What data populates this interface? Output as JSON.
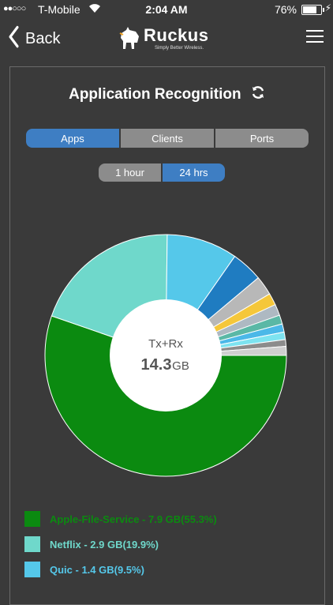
{
  "status_bar": {
    "signal": "●●○○○",
    "carrier": "T-Mobile",
    "time": "2:04 AM",
    "battery_pct": "76%",
    "battery_level": 0.76
  },
  "nav": {
    "back_label": "Back",
    "logo_text": "Ruckus",
    "logo_tagline": "Simply Better Wireless."
  },
  "page": {
    "title": "Application Recognition"
  },
  "tabs": [
    {
      "label": "Apps",
      "active": true
    },
    {
      "label": "Clients",
      "active": false
    },
    {
      "label": "Ports",
      "active": false
    }
  ],
  "time_tabs": [
    {
      "label": "1 hour",
      "active": false
    },
    {
      "label": "24 hrs",
      "active": true
    }
  ],
  "chart_data": {
    "type": "pie",
    "center_label": "Tx+Rx",
    "center_value": "14.3",
    "center_unit": "GB",
    "slices": [
      {
        "label": "Apple-File-Service",
        "value": 55.3,
        "color": "#0b8a10"
      },
      {
        "label": "Netflix",
        "value": 19.9,
        "color": "#6fd8cb"
      },
      {
        "label": "Quic",
        "value": 9.5,
        "color": "#55c8ea"
      },
      {
        "label": "",
        "value": 4.2,
        "color": "#1f7cc1"
      },
      {
        "label": "",
        "value": 2.6,
        "color": "#b8b8b8"
      },
      {
        "label": "",
        "value": 1.6,
        "color": "#f5c73a"
      },
      {
        "label": "",
        "value": 1.5,
        "color": "#aeb9c2"
      },
      {
        "label": "",
        "value": 1.2,
        "color": "#5ab8a6"
      },
      {
        "label": "",
        "value": 1.1,
        "color": "#4bb8e8"
      },
      {
        "label": "",
        "value": 1.0,
        "color": "#7de3f0"
      },
      {
        "label": "",
        "value": 0.9,
        "color": "#8c8c8c"
      },
      {
        "label": "",
        "value": 1.2,
        "color": "#cfcfcf"
      }
    ]
  },
  "legend": [
    {
      "text": "Apple-File-Service - 7.9 GB(55.3%)",
      "color": "#0b8a10"
    },
    {
      "text": "Netflix - 2.9 GB(19.9%)",
      "color": "#6fd8cb"
    },
    {
      "text": "Quic - 1.4 GB(9.5%)",
      "color": "#55c8ea"
    }
  ],
  "icons": {
    "back": "chevron-left-icon",
    "menu": "hamburger-menu-icon",
    "refresh": "refresh-icon",
    "wifi": "wifi-icon",
    "battery": "battery-icon"
  }
}
